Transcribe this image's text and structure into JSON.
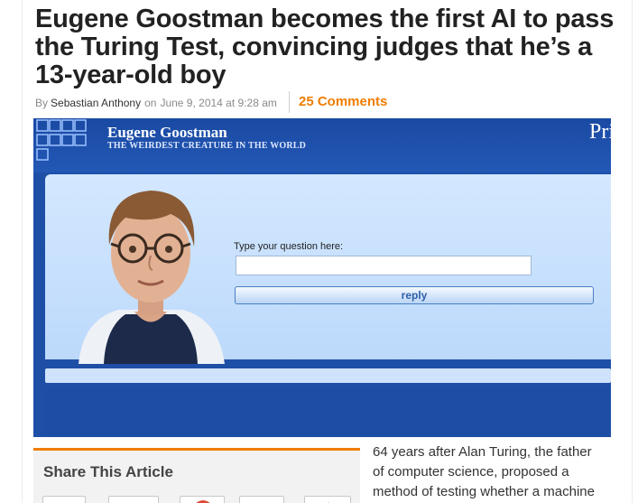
{
  "article": {
    "headline": "Eugene Goostman becomes the first AI to pass the Turing Test, convincing judges that he’s a 13-year-old boy",
    "byline_prefix": "By",
    "author": "Sebastian Anthony",
    "date_prefix": "on",
    "date": "June 9, 2014 at 9:28 am",
    "comments_label": "25 Comments",
    "body_lines": [
      "64 years after Alan Turing, the father",
      "of computer science, proposed a",
      "method of testing whether a machine"
    ]
  },
  "hero_image": {
    "title": "Eugene Goostman",
    "subtitle": "THE WEIRDEST CREATURE IN THE WORLD",
    "corner_text": "Pri",
    "question_label": "Type your question here:",
    "question_value": "",
    "reply_label": "reply"
  },
  "share": {
    "title": "Share This Article"
  },
  "colors": {
    "accent": "#ef7d00",
    "hero_blue": "#1e4fa6",
    "panel_blue": "#c8e0fd"
  }
}
